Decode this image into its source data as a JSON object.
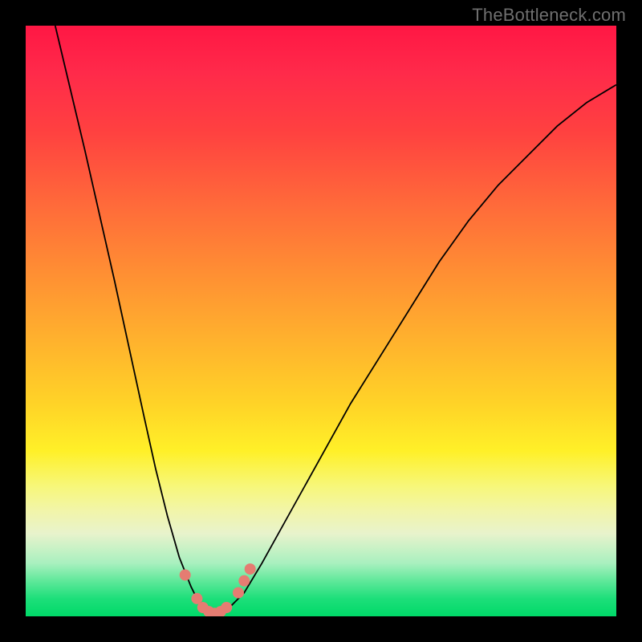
{
  "watermark": "TheBottleneck.com",
  "colors": {
    "frame": "#000000",
    "curve": "#000000",
    "dot": "#e57c72",
    "gradient_top": "#ff1744",
    "gradient_bottom": "#00d968"
  },
  "chart_data": {
    "type": "line",
    "title": "",
    "xlabel": "",
    "ylabel": "",
    "xlim": [
      0,
      100
    ],
    "ylim": [
      0,
      100
    ],
    "x": [
      5,
      10,
      15,
      20,
      22,
      24,
      26,
      28,
      29,
      30,
      31,
      32,
      33,
      34,
      35,
      37,
      40,
      45,
      50,
      55,
      60,
      65,
      70,
      75,
      80,
      85,
      90,
      95,
      100
    ],
    "values": [
      100,
      79,
      57,
      34,
      25,
      17,
      10,
      5,
      3,
      2,
      1,
      0.5,
      0.5,
      1,
      2,
      4,
      9,
      18,
      27,
      36,
      44,
      52,
      60,
      67,
      73,
      78,
      83,
      87,
      90
    ],
    "series": [
      {
        "name": "bottleneck-curve",
        "x": [
          5,
          10,
          15,
          20,
          22,
          24,
          26,
          28,
          29,
          30,
          31,
          32,
          33,
          34,
          35,
          37,
          40,
          45,
          50,
          55,
          60,
          65,
          70,
          75,
          80,
          85,
          90,
          95,
          100
        ],
        "y": [
          100,
          79,
          57,
          34,
          25,
          17,
          10,
          5,
          3,
          2,
          1,
          0.5,
          0.5,
          1,
          2,
          4,
          9,
          18,
          27,
          36,
          44,
          52,
          60,
          67,
          73,
          78,
          83,
          87,
          90
        ]
      }
    ],
    "markers": [
      {
        "x": 27,
        "y": 7
      },
      {
        "x": 29,
        "y": 3
      },
      {
        "x": 30,
        "y": 1.5
      },
      {
        "x": 31,
        "y": 0.8
      },
      {
        "x": 32,
        "y": 0.5
      },
      {
        "x": 33,
        "y": 0.8
      },
      {
        "x": 34,
        "y": 1.5
      },
      {
        "x": 36,
        "y": 4
      },
      {
        "x": 37,
        "y": 6
      },
      {
        "x": 38,
        "y": 8
      }
    ]
  }
}
